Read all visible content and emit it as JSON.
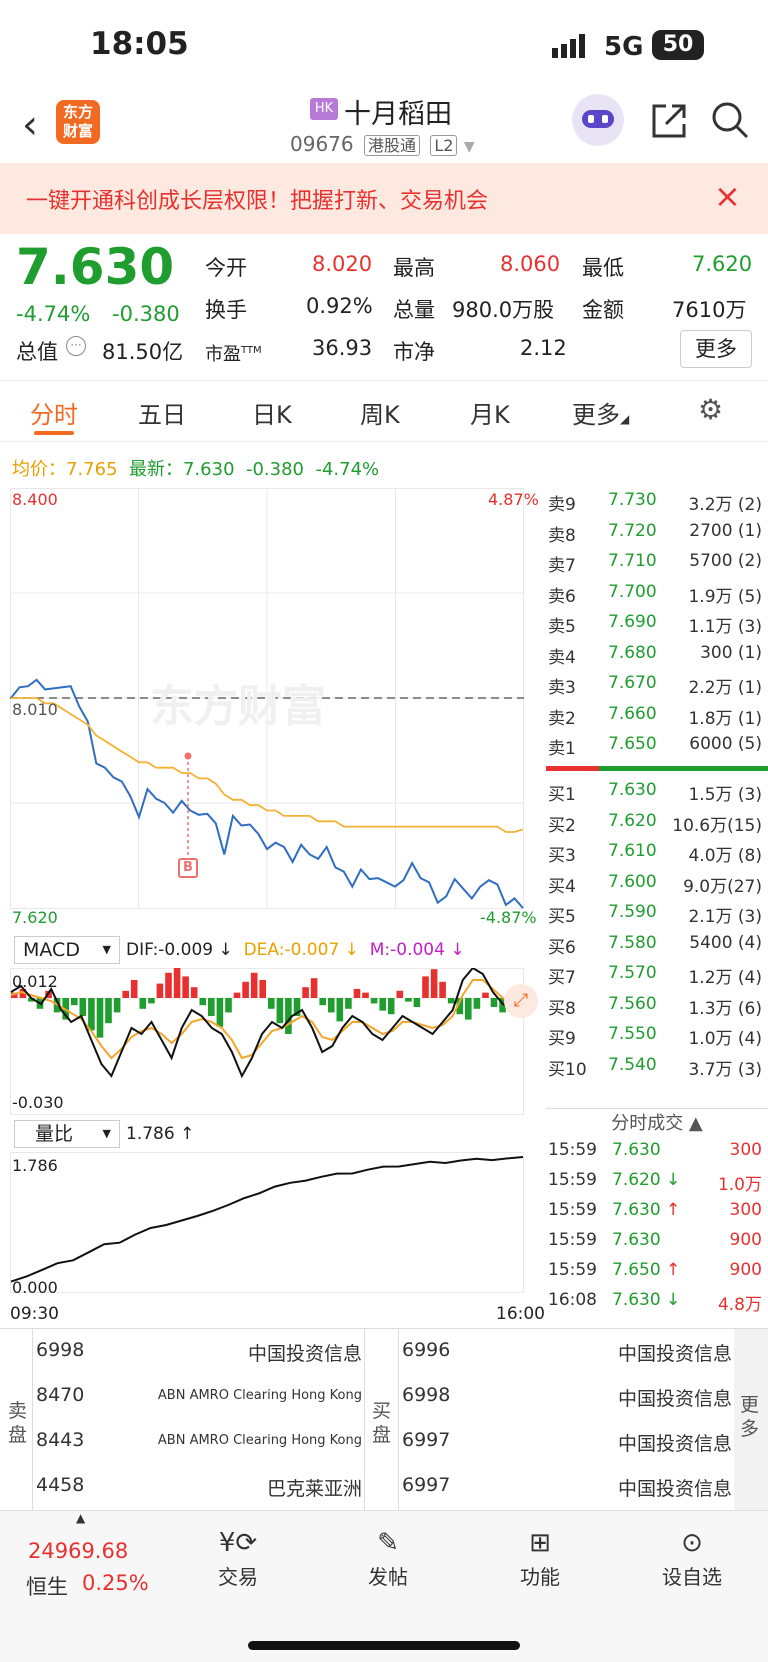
{
  "status": {
    "time": "18:05",
    "network": "5G",
    "battery": "50"
  },
  "header": {
    "market_tag": "HK",
    "name": "十月稻田",
    "code": "09676",
    "tag1": "港股通",
    "tag2": "L2"
  },
  "banner": {
    "text": "一键开通科创成长层权限！把握打新、交易机会"
  },
  "quote": {
    "price": "7.630",
    "change_pct": "-4.74%",
    "change": "-0.380",
    "open_label": "今开",
    "open": "8.020",
    "high_label": "最高",
    "high": "8.060",
    "low_label": "最低",
    "low": "7.620",
    "turnover_label": "换手",
    "turnover": "0.92%",
    "volume_label": "总量",
    "volume": "980.0万股",
    "amount_label": "金额",
    "amount": "7610万",
    "mcap_label": "总值",
    "mcap": "81.50亿",
    "pe_label": "市盈",
    "pe_sup": "TTM",
    "pe": "36.93",
    "pb_label": "市净",
    "pb": "2.12",
    "more": "更多"
  },
  "tabs": [
    "分时",
    "五日",
    "日K",
    "周K",
    "月K",
    "更多"
  ],
  "chart_info": {
    "avg_label": "均价：",
    "avg": "7.765",
    "last_label": "最新：",
    "last": "7.630",
    "chg": "-0.380",
    "pct": "-4.74%"
  },
  "chart_data": {
    "type": "line",
    "x_start": "09:30",
    "x_end": "16:00",
    "y_max": "8.400",
    "y_min": "7.620",
    "y_ref": "8.010",
    "pct_max": "4.87%",
    "pct_min": "-4.87%",
    "marker": "B",
    "watermark": "东方财富",
    "series": [
      {
        "name": "",
        "color": "#2f6ec1",
        "values": [
          8.01,
          8.03,
          8.02,
          8.05,
          8.02,
          8.04,
          8.03,
          8.02,
          8.0,
          7.96,
          7.9,
          7.88,
          7.85,
          7.86,
          7.82,
          7.8,
          7.84,
          7.81,
          7.82,
          7.79,
          7.83,
          7.8,
          7.78,
          7.8,
          7.77,
          7.73,
          7.79,
          7.76,
          7.78,
          7.75,
          7.74,
          7.74,
          7.72,
          7.71,
          7.73,
          7.73,
          7.71,
          7.72,
          7.7,
          7.68,
          7.67,
          7.69,
          7.66,
          7.68,
          7.66,
          7.67,
          7.67,
          7.69,
          7.68,
          7.66,
          7.64,
          7.64,
          7.66,
          7.66,
          7.63,
          7.67,
          7.67,
          7.65,
          7.63,
          7.63,
          7.63
        ]
      },
      {
        "name": "",
        "color": "#f2b233",
        "values": [
          8.01,
          8.01,
          8.01,
          8.01,
          8.0,
          8.0,
          7.99,
          7.98,
          7.97,
          7.96,
          7.94,
          7.93,
          7.92,
          7.91,
          7.9,
          7.89,
          7.89,
          7.88,
          7.88,
          7.88,
          7.87,
          7.87,
          7.86,
          7.86,
          7.85,
          7.83,
          7.82,
          7.82,
          7.81,
          7.81,
          7.8,
          7.8,
          7.79,
          7.79,
          7.79,
          7.79,
          7.78,
          7.78,
          7.78,
          7.77,
          7.77,
          7.77,
          7.77,
          7.77,
          7.77,
          7.77,
          7.77,
          7.77,
          7.77,
          7.77,
          7.77,
          7.77,
          7.77,
          7.77,
          7.77,
          7.77,
          7.77,
          7.77,
          7.76,
          7.76,
          7.765
        ]
      }
    ]
  },
  "macd": {
    "label": "MACD",
    "dif": "DIF:-0.009 ↓",
    "dea": "DEA:-0.007 ↓",
    "m": "M:-0.004 ↓",
    "top": "0.012",
    "bottom": "-0.030",
    "bars": [
      3,
      5,
      -2,
      -6,
      4,
      -8,
      -12,
      -4,
      -10,
      -18,
      -22,
      -14,
      -8,
      4,
      10,
      -6,
      -3,
      8,
      14,
      20,
      12,
      6,
      -4,
      -10,
      -16,
      -8,
      3,
      9,
      14,
      10,
      -6,
      -14,
      -20,
      -10,
      6,
      11,
      -4,
      -8,
      -13,
      -6,
      5,
      3,
      -3,
      -7,
      -9,
      4,
      -2,
      -5,
      12,
      16,
      9,
      -3,
      -9,
      -12,
      -6,
      3,
      -5,
      -8,
      -4,
      -6
    ],
    "dif_series": [
      2,
      4,
      0,
      -2,
      3,
      -4,
      -8,
      -6,
      -14,
      -22,
      -26,
      -18,
      -10,
      -12,
      -8,
      -14,
      -20,
      -10,
      -4,
      -6,
      -10,
      -12,
      -18,
      -26,
      -20,
      -12,
      -8,
      -10,
      -6,
      -4,
      -10,
      -18,
      -16,
      -10,
      -6,
      -8,
      -12,
      -14,
      -10,
      -6,
      -8,
      -10,
      -12,
      -8,
      -4,
      6,
      10,
      8,
      2,
      -2,
      -4,
      -6
    ],
    "dea_series": [
      1,
      2,
      1,
      0,
      -1,
      -3,
      -5,
      -7,
      -11,
      -16,
      -20,
      -17,
      -13,
      -11,
      -10,
      -12,
      -15,
      -12,
      -8,
      -7,
      -8,
      -10,
      -14,
      -20,
      -19,
      -15,
      -11,
      -10,
      -8,
      -6,
      -8,
      -13,
      -14,
      -11,
      -8,
      -8,
      -10,
      -12,
      -11,
      -8,
      -8,
      -9,
      -10,
      -9,
      -6,
      1,
      6,
      6,
      3,
      0,
      -2,
      -4
    ]
  },
  "volratio": {
    "label": "量比",
    "value": "1.786 ↑",
    "top": "1.786",
    "bottom": "0.000",
    "series": [
      0.02,
      0.12,
      0.2,
      0.28,
      0.35,
      0.45,
      0.55,
      0.6,
      0.7,
      0.78,
      0.85,
      0.9,
      0.95,
      1.05,
      1.12,
      1.2,
      1.3,
      1.38,
      1.42,
      1.48,
      1.52,
      1.55,
      1.58,
      1.62,
      1.65,
      1.68,
      1.7,
      1.72,
      1.73,
      1.75,
      1.76,
      1.77,
      1.78,
      1.786
    ]
  },
  "orderbook": {
    "sells": [
      [
        "卖9",
        "7.730",
        "3.2万 (2)"
      ],
      [
        "卖8",
        "7.720",
        "2700 (1)"
      ],
      [
        "卖7",
        "7.710",
        "5700 (2)"
      ],
      [
        "卖6",
        "7.700",
        "1.9万 (5)"
      ],
      [
        "卖5",
        "7.690",
        "1.1万 (3)"
      ],
      [
        "卖4",
        "7.680",
        "300 (1)"
      ],
      [
        "卖3",
        "7.670",
        "2.2万 (1)"
      ],
      [
        "卖2",
        "7.660",
        "1.8万 (1)"
      ],
      [
        "卖1",
        "7.650",
        "6000 (5)"
      ]
    ],
    "buys": [
      [
        "买1",
        "7.630",
        "1.5万 (3)"
      ],
      [
        "买2",
        "7.620",
        "10.6万(15)"
      ],
      [
        "买3",
        "7.610",
        "4.0万 (8)"
      ],
      [
        "买4",
        "7.600",
        "9.0万(27)"
      ],
      [
        "买5",
        "7.590",
        "2.1万 (3)"
      ],
      [
        "买6",
        "7.580",
        "5400 (4)"
      ],
      [
        "买7",
        "7.570",
        "1.2万 (4)"
      ],
      [
        "买8",
        "7.560",
        "1.3万 (6)"
      ],
      [
        "买9",
        "7.550",
        "1.0万 (4)"
      ],
      [
        "买10",
        "7.540",
        "3.7万 (3)"
      ]
    ],
    "ratio_sell": 0.12
  },
  "ticks": {
    "title": "分时成交 ▲",
    "rows": [
      [
        "15:59",
        "7.630",
        "",
        "300"
      ],
      [
        "15:59",
        "7.620",
        "↓",
        "1.0万"
      ],
      [
        "15:59",
        "7.630",
        "↑",
        "300"
      ],
      [
        "15:59",
        "7.630",
        "",
        "900"
      ],
      [
        "15:59",
        "7.650",
        "↑",
        "900"
      ],
      [
        "16:08",
        "7.630",
        "↓",
        "4.8万"
      ]
    ]
  },
  "brokers": {
    "sell_label": "卖盘",
    "buy_label": "买盘",
    "more": "更多",
    "sell": [
      [
        "6998",
        "中国投资信息"
      ],
      [
        "8470",
        "ABN AMRO Clearing Hong Kong"
      ],
      [
        "8443",
        "ABN AMRO Clearing Hong Kong"
      ],
      [
        "4458",
        "巴克莱亚洲"
      ]
    ],
    "buy": [
      [
        "6996",
        "中国投资信息"
      ],
      [
        "6998",
        "中国投资信息"
      ],
      [
        "6997",
        "中国投资信息"
      ],
      [
        "6997",
        "中国投资信息"
      ]
    ]
  },
  "bottom": {
    "index_value": "24969.68",
    "index_name": "恒生",
    "index_pct": "0.25%",
    "trade": "交易",
    "post": "发帖",
    "func": "功能",
    "watch": "设自选"
  }
}
